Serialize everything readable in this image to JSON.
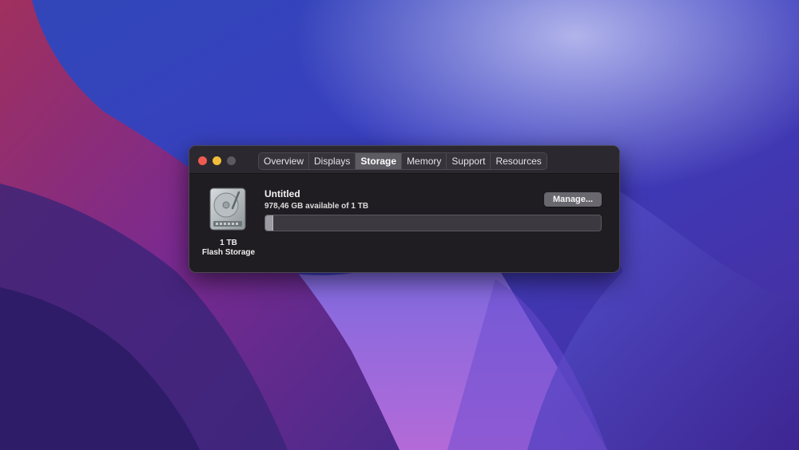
{
  "window": {
    "tabs": [
      {
        "label": "Overview",
        "active": false
      },
      {
        "label": "Displays",
        "active": false
      },
      {
        "label": "Storage",
        "active": true
      },
      {
        "label": "Memory",
        "active": false
      },
      {
        "label": "Support",
        "active": false
      },
      {
        "label": "Resources",
        "active": false
      }
    ]
  },
  "storage": {
    "device_size": "1 TB",
    "device_type": "Flash Storage",
    "volume_name": "Untitled",
    "available_text": "978,46 GB available of 1 TB",
    "used_fraction": 0.022,
    "manage_label": "Manage...",
    "icon": "hard-drive-icon"
  },
  "colors": {
    "close": "#ee5a52",
    "minimize": "#f2bd3a",
    "maximize": "#5b5a60",
    "active_tab": "#5e5c63"
  }
}
